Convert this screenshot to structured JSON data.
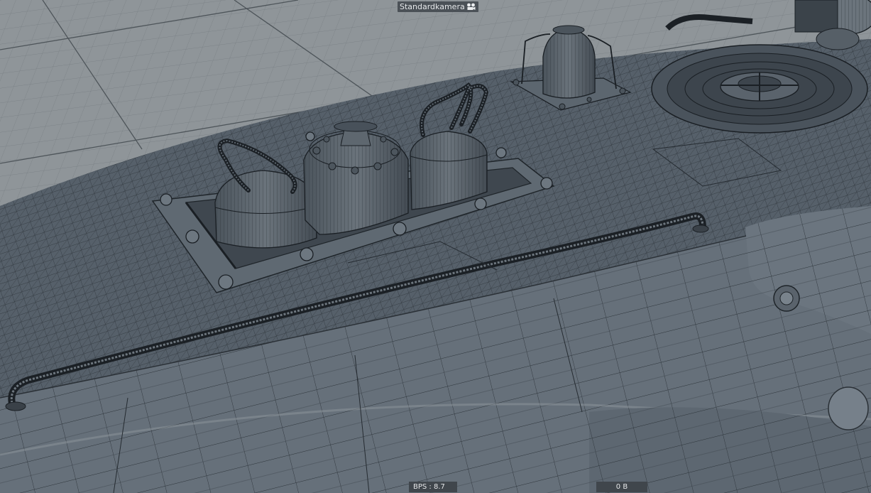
{
  "viewport": {
    "camera_name": "Standardkamera",
    "camera_icon": "camera-icon"
  },
  "hud": {
    "bps": "BPS : 8.7",
    "memory": "0 B"
  },
  "colors": {
    "floor": "#8f9599",
    "grid_line": "#5f666b",
    "hull": "#56606a",
    "hull_side": "#6a747d",
    "wire": "#1a1f24"
  }
}
